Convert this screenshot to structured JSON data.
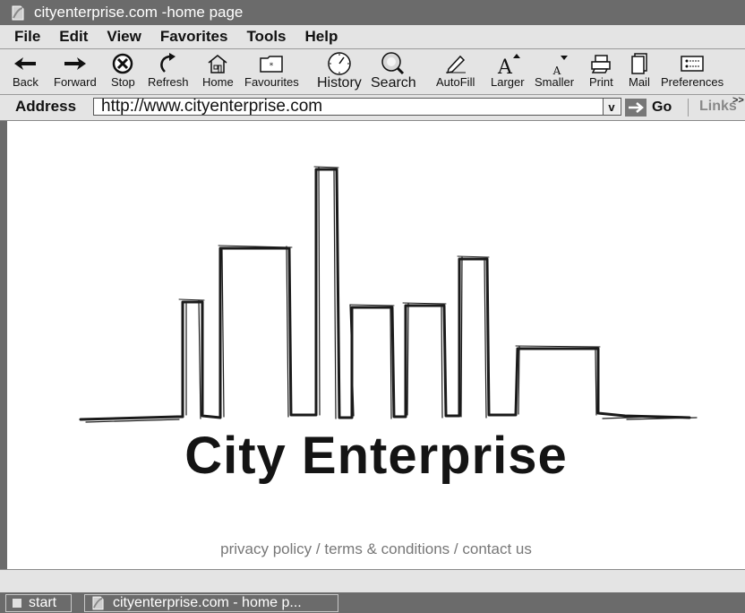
{
  "window": {
    "title": "cityenterprise.com -home page"
  },
  "menu": [
    "File",
    "Edit",
    "View",
    "Favorites",
    "Tools",
    "Help"
  ],
  "toolbar": {
    "back": "Back",
    "forward": "Forward",
    "stop": "Stop",
    "refresh": "Refresh",
    "home": "Home",
    "favourites": "Favourites",
    "history": "History",
    "search": "Search",
    "autofill": "AutoFill",
    "larger": "Larger",
    "smaller": "Smaller",
    "print": "Print",
    "mail": "Mail",
    "preferences": "Preferences"
  },
  "address": {
    "label": "Address",
    "url": "http://www.cityenterprise.com",
    "dropdown_glyph": "v",
    "go_label": "Go",
    "links_label": "Links",
    "links_more": ">>"
  },
  "page": {
    "brand": "City Enterprise",
    "footer": {
      "privacy": "privacy policy",
      "sep1": " / ",
      "terms": "terms & conditions",
      "sep2": " / ",
      "contact": "contact us"
    }
  },
  "taskbar": {
    "start": "start",
    "task": "cityenterprise.com - home p..."
  },
  "icons": {
    "back": "left-arrow-icon",
    "forward": "right-arrow-icon",
    "stop": "stop-icon",
    "refresh": "refresh-icon",
    "home": "home-icon",
    "favourites": "favourites-folder-icon",
    "history": "clock-icon",
    "search": "magnifier-icon",
    "autofill": "pencil-icon",
    "larger": "text-larger-icon",
    "smaller": "text-smaller-icon",
    "print": "printer-icon",
    "mail": "mail-icon",
    "preferences": "preferences-icon",
    "page": "document-icon"
  },
  "colors": {
    "chrome_dark": "#6b6b6b",
    "chrome_light": "#e4e4e4",
    "footer_text": "#777777",
    "brand_text": "#141414"
  }
}
